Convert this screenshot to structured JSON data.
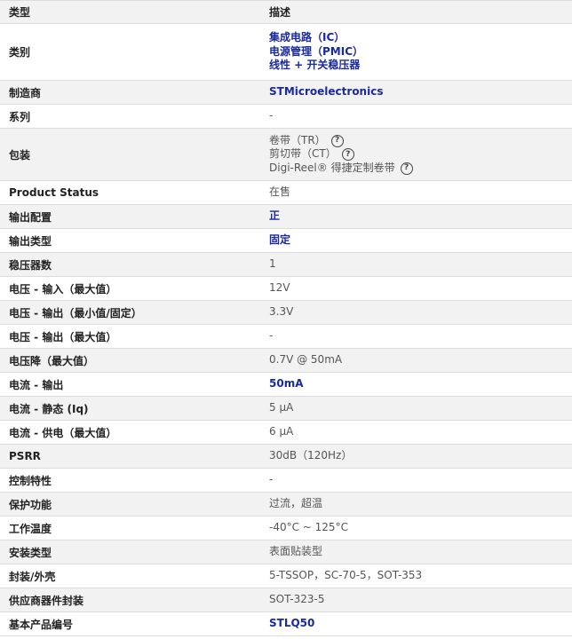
{
  "header": {
    "col1": "类型",
    "col2": "描述"
  },
  "rows": [
    {
      "label": "类别",
      "values": [
        "集成电路（IC）",
        "电源管理（PMIC）",
        "线性 + 开关稳压器"
      ],
      "link": true
    },
    {
      "label": "制造商",
      "values": [
        "STMicroelectronics"
      ],
      "link": true
    },
    {
      "label": "系列",
      "values": [
        "-"
      ],
      "link": false
    },
    {
      "label": "包装",
      "values": [
        "卷带（TR）",
        "剪切带（CT）",
        "Digi-Reel® 得捷定制卷带"
      ],
      "link": false,
      "help": true
    },
    {
      "label": "Product Status",
      "values": [
        "在售"
      ],
      "link": false
    },
    {
      "label": "输出配置",
      "values": [
        "正"
      ],
      "link": true
    },
    {
      "label": "输出类型",
      "values": [
        "固定"
      ],
      "link": true
    },
    {
      "label": "稳压器数",
      "values": [
        "1"
      ],
      "link": false
    },
    {
      "label": "电压 - 输入（最大值）",
      "values": [
        "12V"
      ],
      "link": false
    },
    {
      "label": "电压 - 输出（最小值/固定）",
      "values": [
        "3.3V"
      ],
      "link": false
    },
    {
      "label": "电压 - 输出（最大值）",
      "values": [
        "-"
      ],
      "link": false
    },
    {
      "label": "电压降（最大值）",
      "values": [
        "0.7V @ 50mA"
      ],
      "link": false
    },
    {
      "label": "电流 - 输出",
      "values": [
        "50mA"
      ],
      "link": true
    },
    {
      "label": "电流 - 静态 (Iq)",
      "values": [
        "5 µA"
      ],
      "link": false
    },
    {
      "label": "电流 - 供电（最大值）",
      "values": [
        "6 µA"
      ],
      "link": false
    },
    {
      "label": "PSRR",
      "values": [
        "30dB（120Hz）"
      ],
      "link": false
    },
    {
      "label": "控制特性",
      "values": [
        "-"
      ],
      "link": false
    },
    {
      "label": "保护功能",
      "values": [
        "过流，超温"
      ],
      "link": false
    },
    {
      "label": "工作温度",
      "values": [
        "-40°C ~ 125°C"
      ],
      "link": false
    },
    {
      "label": "安装类型",
      "values": [
        "表面贴装型"
      ],
      "link": false
    },
    {
      "label": "封装/外壳",
      "values": [
        "5-TSSOP，SC-70-5，SOT-353"
      ],
      "link": false
    },
    {
      "label": "供应商器件封装",
      "values": [
        "SOT-323-5"
      ],
      "link": false
    },
    {
      "label": "基本产品编号",
      "values": [
        "STLQ50"
      ],
      "link": true
    }
  ],
  "help_icon": {
    "name": "question-circle-icon",
    "glyph": "?"
  },
  "colors": {
    "link": "#1a2a9c",
    "row_alt": "#f2f2f2",
    "border": "#dcdcdc"
  }
}
